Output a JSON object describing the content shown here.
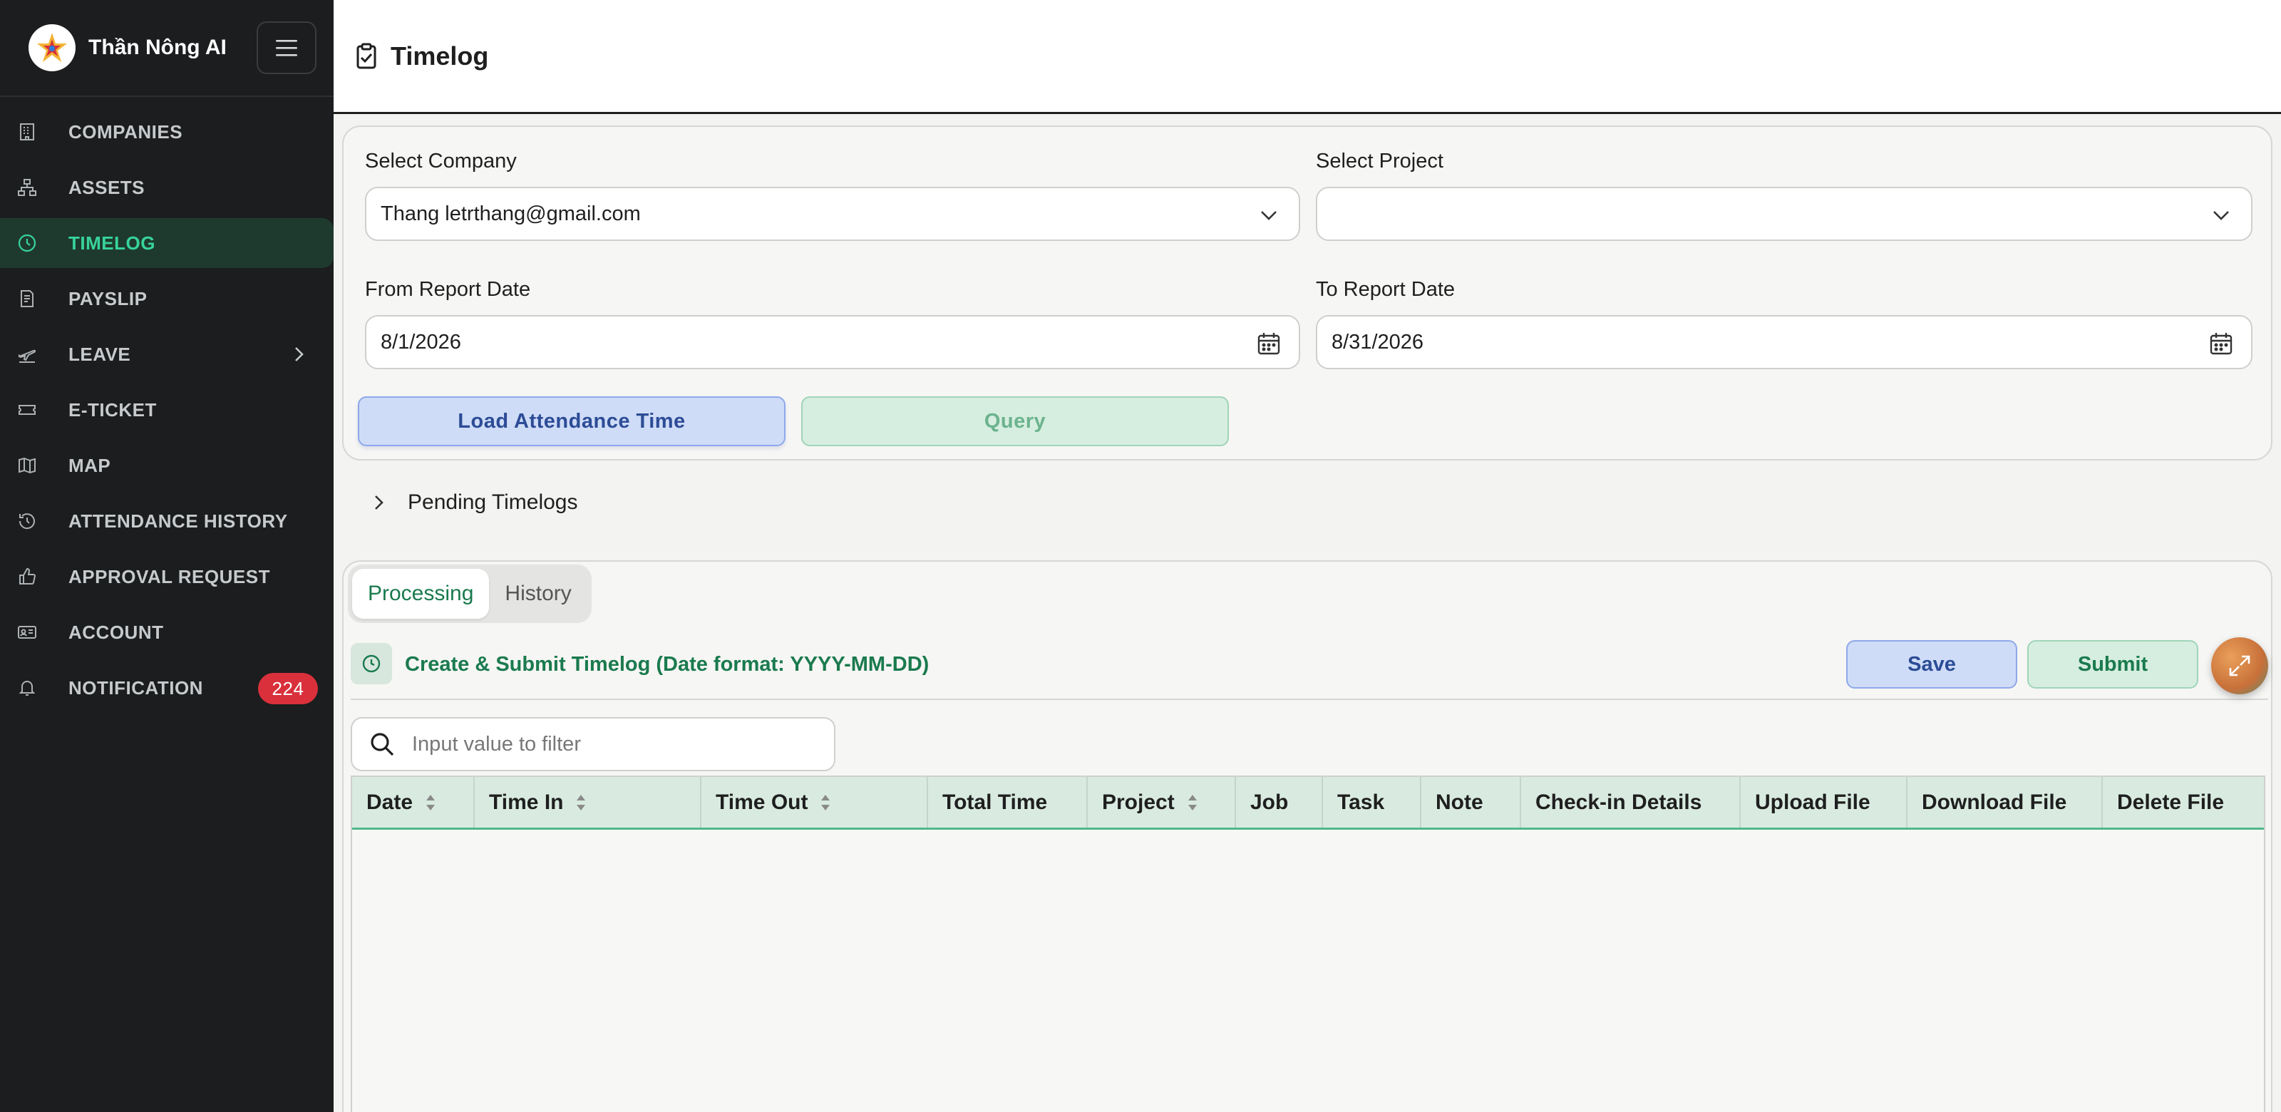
{
  "app": {
    "brand_name": "Thần Nông AI",
    "page_title": "Timelog"
  },
  "sidebar": {
    "items": [
      {
        "label": "COMPANIES",
        "icon": "building-icon",
        "active": false
      },
      {
        "label": "ASSETS",
        "icon": "hierarchy-icon",
        "active": false
      },
      {
        "label": "TIMELOG",
        "icon": "clock-icon",
        "active": true
      },
      {
        "label": "PAYSLIP",
        "icon": "receipt-icon",
        "active": false
      },
      {
        "label": "LEAVE",
        "icon": "plane-icon",
        "active": false,
        "has_submenu": true
      },
      {
        "label": "E-TICKET",
        "icon": "ticket-icon",
        "active": false
      },
      {
        "label": "MAP",
        "icon": "map-icon",
        "active": false
      },
      {
        "label": "ATTENDANCE HISTORY",
        "icon": "history-icon",
        "active": false
      },
      {
        "label": "APPROVAL REQUEST",
        "icon": "thumbs-up-icon",
        "active": false
      },
      {
        "label": "ACCOUNT",
        "icon": "id-card-icon",
        "active": false
      },
      {
        "label": "NOTIFICATION",
        "icon": "bell-icon",
        "active": false,
        "badge": "224"
      }
    ]
  },
  "filters": {
    "company_label": "Select Company",
    "company_value": "Thang letrthang@gmail.com",
    "project_label": "Select Project",
    "project_value": "",
    "from_label": "From Report Date",
    "from_value": "8/1/2026",
    "to_label": "To Report Date",
    "to_value": "8/31/2026",
    "load_button": "Load Attendance Time",
    "query_button": "Query"
  },
  "pending": {
    "label": "Pending Timelogs"
  },
  "timelog": {
    "tabs": [
      {
        "label": "Processing",
        "active": true
      },
      {
        "label": "History",
        "active": false
      }
    ],
    "create_title": "Create & Submit Timelog (Date format: YYYY-MM-DD)",
    "save_button": "Save",
    "submit_button": "Submit",
    "search_placeholder": "Input value to filter",
    "columns": [
      {
        "label": "Date",
        "sortable": true
      },
      {
        "label": "Time In",
        "sortable": true
      },
      {
        "label": "Time Out",
        "sortable": true
      },
      {
        "label": "Total Time",
        "sortable": false
      },
      {
        "label": "Project",
        "sortable": true
      },
      {
        "label": "Job",
        "sortable": false
      },
      {
        "label": "Task",
        "sortable": false
      },
      {
        "label": "Note",
        "sortable": false
      },
      {
        "label": "Check-in Details",
        "sortable": false
      },
      {
        "label": "Upload File",
        "sortable": false
      },
      {
        "label": "Download File",
        "sortable": false
      },
      {
        "label": "Delete File",
        "sortable": false
      }
    ],
    "rows": []
  },
  "colors": {
    "sidebar_bg": "#1b1d1e",
    "active_accent": "#37d39b",
    "primary_green": "#1a7a4e",
    "badge_red": "#d9303b",
    "blue_button": "#cfdcf7"
  }
}
